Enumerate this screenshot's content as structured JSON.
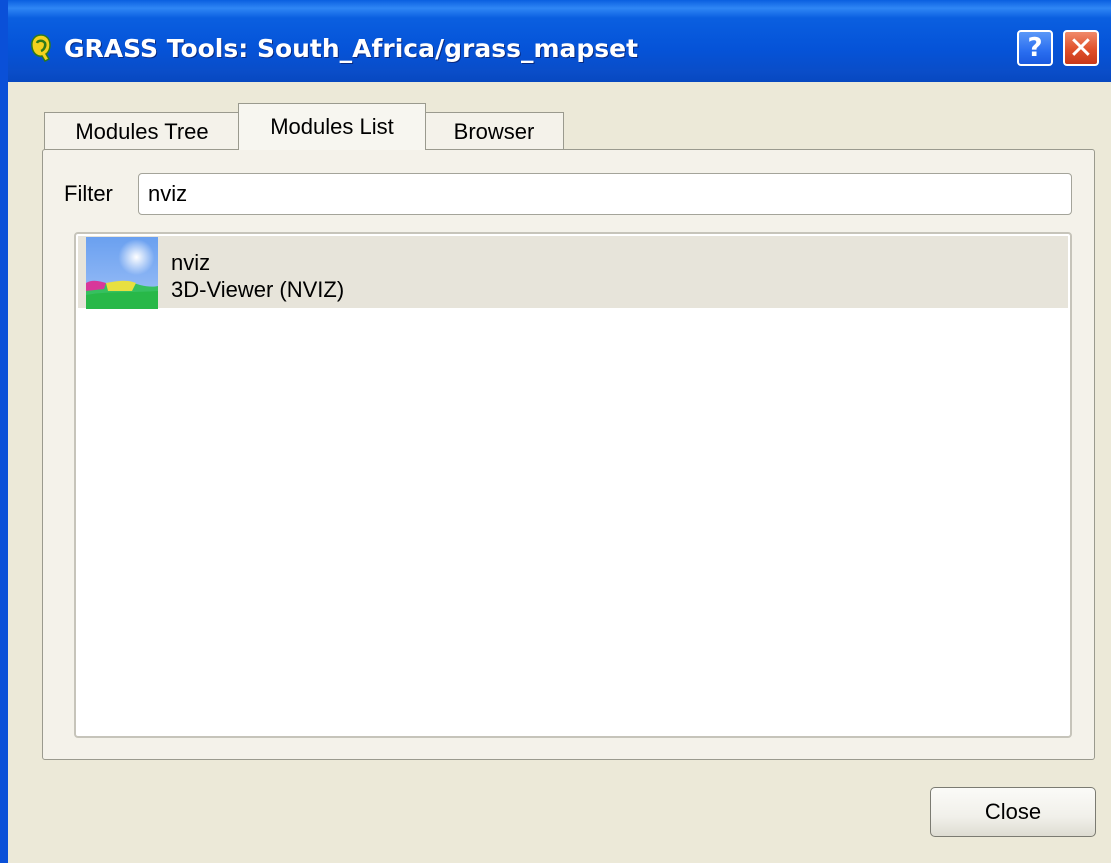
{
  "window": {
    "title": "GRASS Tools: South_Africa/grass_mapset",
    "help_label": "?",
    "close_label": "✕"
  },
  "tabs": [
    {
      "label": "Modules Tree",
      "active": false
    },
    {
      "label": "Modules List",
      "active": true
    },
    {
      "label": "Browser",
      "active": false
    }
  ],
  "filter": {
    "label": "Filter",
    "value": "nviz"
  },
  "modules": [
    {
      "name": "nviz",
      "description": "3D-Viewer (NVIZ)",
      "icon": "nviz-3d-viewer-icon",
      "selected": true
    }
  ],
  "footer": {
    "close_label": "Close"
  },
  "colors": {
    "titlebar": "#0a5fe0",
    "window_bg": "#ece9d8",
    "selected_row": "#e7e4da"
  }
}
